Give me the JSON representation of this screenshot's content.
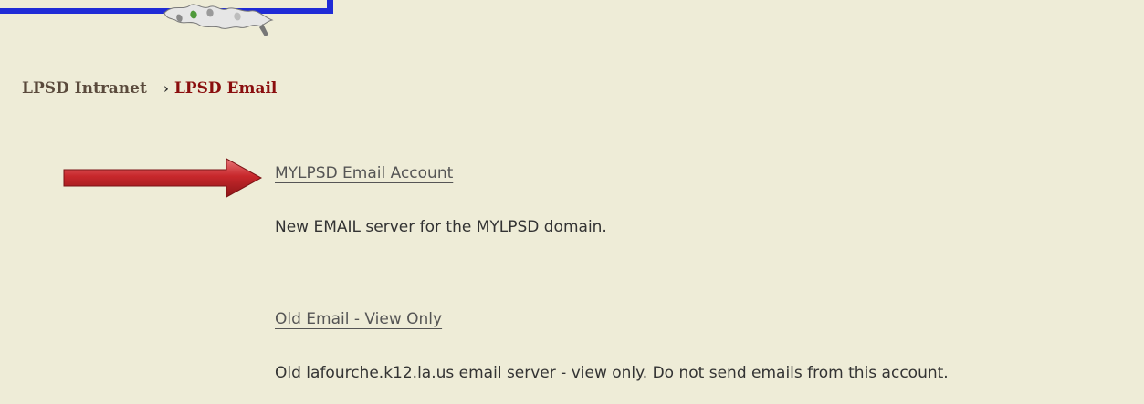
{
  "header": {
    "logo_icon": "decorative-leaf-logo-icon"
  },
  "breadcrumb": {
    "parent_label": "LPSD Intranet",
    "separator": "›",
    "current_label": "LPSD Email"
  },
  "links": [
    {
      "label": "MYLPSD Email Account",
      "description": "New EMAIL server for the MYLPSD domain."
    },
    {
      "label": "Old Email - View Only",
      "description": "Old lafourche.k12.la.us email server - view only. Do not send emails from this account."
    }
  ],
  "colors": {
    "background": "#eeecd7",
    "banner": "#1f2bd6",
    "current_crumb": "#8a0e0e",
    "arrow": "#c0282b"
  }
}
